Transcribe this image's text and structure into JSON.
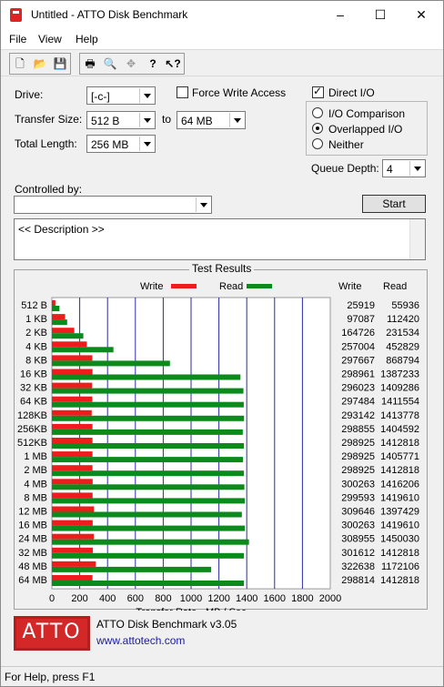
{
  "window": {
    "title": "Untitled - ATTO Disk Benchmark",
    "minimize": "–",
    "maximize": "☐",
    "close": "✕"
  },
  "menu": {
    "items": [
      "File",
      "View",
      "Help"
    ]
  },
  "toolbar": {
    "icons": [
      "new-file-icon",
      "open-folder-icon",
      "save-icon",
      "print-icon",
      "print-preview-icon",
      "move-icon",
      "help-icon",
      "context-help-icon"
    ],
    "icon_glyphs": [
      "🗋",
      "📂",
      "💾",
      "🖶",
      "🔍",
      "✥",
      "?",
      "↖?"
    ]
  },
  "settings": {
    "drive_label": "Drive:",
    "drive_value": "[-c-]",
    "transfer_size_label": "Transfer Size:",
    "transfer_from": "512 B",
    "to_label": "to",
    "transfer_to": "64 MB",
    "total_length_label": "Total Length:",
    "total_length_value": "256 MB",
    "force_write_access_label": "Force Write Access",
    "force_write_access_checked": false,
    "direct_io_label": "Direct I/O",
    "direct_io_checked": true,
    "io_comparison_label": "I/O Comparison",
    "overlapped_io_label": "Overlapped I/O",
    "neither_label": "Neither",
    "selected_io_mode": "Overlapped I/O",
    "queue_depth_label": "Queue Depth:",
    "queue_depth_value": "4",
    "controlled_by_label": "Controlled by:",
    "controlled_by_value": "",
    "start_label": "Start",
    "description": "<< Description >>"
  },
  "results": {
    "title": "Test Results",
    "write_legend": "Write",
    "read_legend": "Read",
    "write_col": "Write",
    "read_col": "Read",
    "write_color": "#ee1c1c",
    "read_color": "#0c8a1c",
    "grid_color": "#2a2aa6"
  },
  "chart_data": {
    "type": "bar",
    "orientation": "horizontal",
    "categories": [
      "512 B",
      "1 KB",
      "2 KB",
      "4 KB",
      "8 KB",
      "16 KB",
      "32 KB",
      "64 KB",
      "128KB",
      "256KB",
      "512KB",
      "1 MB",
      "2 MB",
      "4 MB",
      "8 MB",
      "12 MB",
      "16 MB",
      "24 MB",
      "32 MB",
      "48 MB",
      "64 MB"
    ],
    "series": [
      {
        "name": "Write",
        "values": [
          25919,
          97087,
          164726,
          257004,
          297667,
          298961,
          296023,
          297484,
          293142,
          298855,
          298925,
          298925,
          298925,
          300263,
          299593,
          309646,
          300263,
          308955,
          301612,
          322638,
          298814
        ]
      },
      {
        "name": "Read",
        "values": [
          55936,
          112420,
          231534,
          452829,
          868794,
          1387233,
          1409286,
          1411554,
          1413778,
          1404592,
          1412818,
          1405771,
          1412818,
          1416206,
          1419610,
          1397429,
          1419610,
          1450030,
          1412818,
          1172106,
          1412818
        ]
      }
    ],
    "xlabel": "Transfer Rate - MB / Sec",
    "xlim": [
      0,
      2000
    ],
    "xticks": [
      "0",
      "200",
      "400",
      "600",
      "800",
      "1000",
      "1200",
      "1400",
      "1600",
      "1800",
      "2000"
    ],
    "grid": true,
    "legend": "top"
  },
  "branding": {
    "logo_text": "ATTO",
    "product": "ATTO Disk Benchmark v3.05",
    "url": "www.attotech.com"
  },
  "status": {
    "text": "For Help, press F1"
  }
}
